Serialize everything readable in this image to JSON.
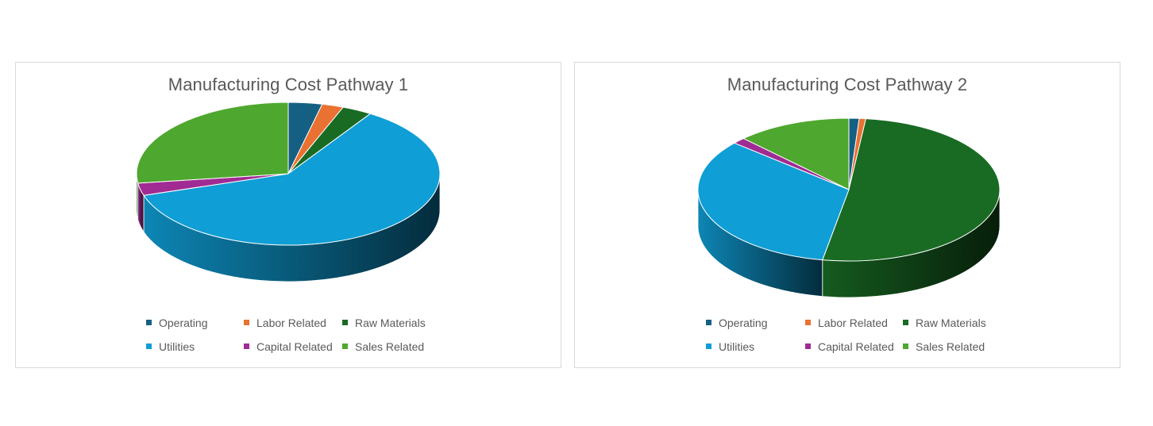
{
  "legend_labels": [
    "Operating",
    "Labor Related",
    "Raw Materials",
    "Utilities",
    "Capital Related",
    "Sales Related"
  ],
  "colors": {
    "Operating": "#156082",
    "Labor Related": "#e97132",
    "Raw Materials": "#196b24",
    "Utilities": "#0f9ed5",
    "Capital Related": "#a02b93",
    "Sales Related": "#4ea72e"
  },
  "chart_data": [
    {
      "type": "pie",
      "title": "Manufacturing Cost Pathway 1",
      "categories": [
        "Operating",
        "Labor Related",
        "Raw Materials",
        "Utilities",
        "Capital Related",
        "Sales Related"
      ],
      "values": [
        3.6,
        2.3,
        3.2,
        61.0,
        2.8,
        27.1
      ],
      "style": "3d",
      "legend": "bottom"
    },
    {
      "type": "pie",
      "title": "Manufacturing Cost Pathway 2",
      "categories": [
        "Operating",
        "Labor Related",
        "Raw Materials",
        "Utilities",
        "Capital Related",
        "Sales Related"
      ],
      "values": [
        1.1,
        0.7,
        51.0,
        33.5,
        1.4,
        12.3
      ],
      "style": "3d",
      "legend": "bottom"
    }
  ]
}
